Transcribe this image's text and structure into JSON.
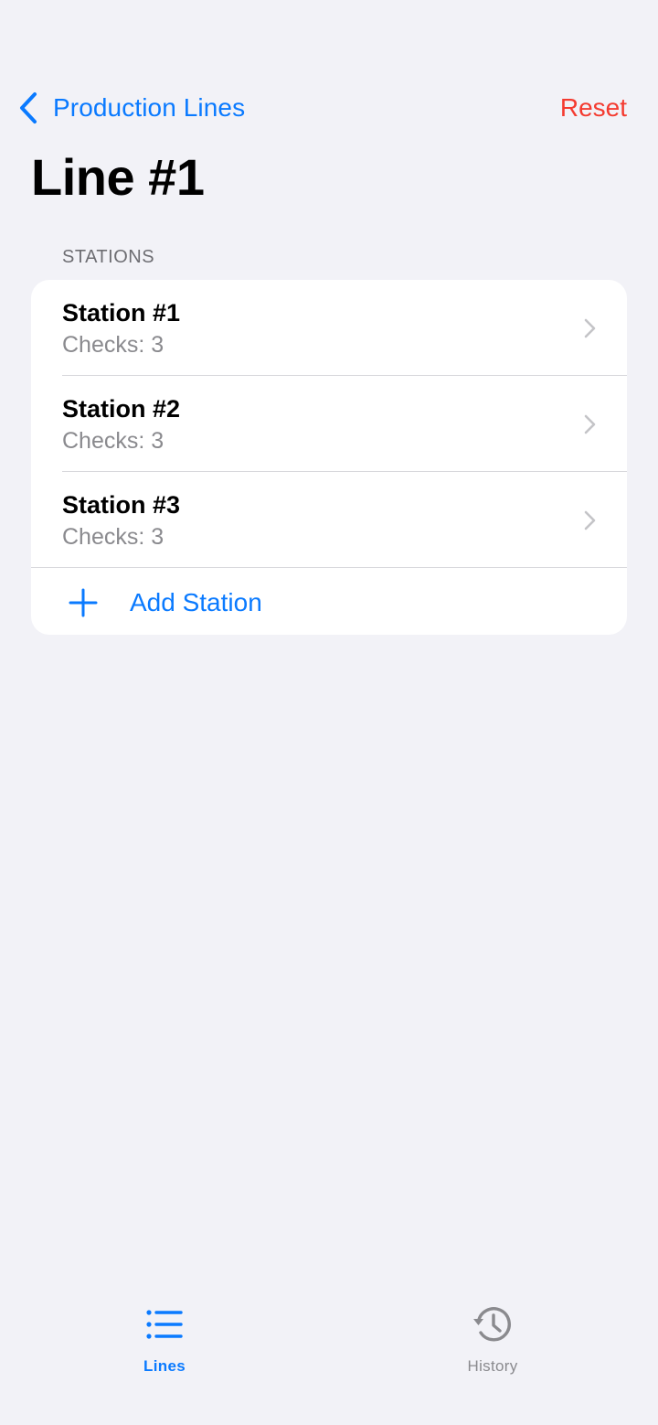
{
  "colors": {
    "accent": "#0a7aff",
    "destructive": "#f43b30",
    "background": "#f2f2f7",
    "secondary_text": "#8a8a8e"
  },
  "nav": {
    "back_label": "Production Lines",
    "back_icon": "chevron-left-icon",
    "reset_label": "Reset"
  },
  "page": {
    "title": "Line #1"
  },
  "stations_section": {
    "header": "STATIONS",
    "items": [
      {
        "title": "Station #1",
        "subtitle": "Checks: 3"
      },
      {
        "title": "Station #2",
        "subtitle": "Checks: 3"
      },
      {
        "title": "Station #3",
        "subtitle": "Checks: 3"
      }
    ],
    "add_label": "Add Station",
    "add_icon": "plus-icon"
  },
  "tabs": [
    {
      "label": "Lines",
      "icon": "list-icon",
      "selected": true
    },
    {
      "label": "History",
      "icon": "history-clock-icon",
      "selected": false
    }
  ]
}
